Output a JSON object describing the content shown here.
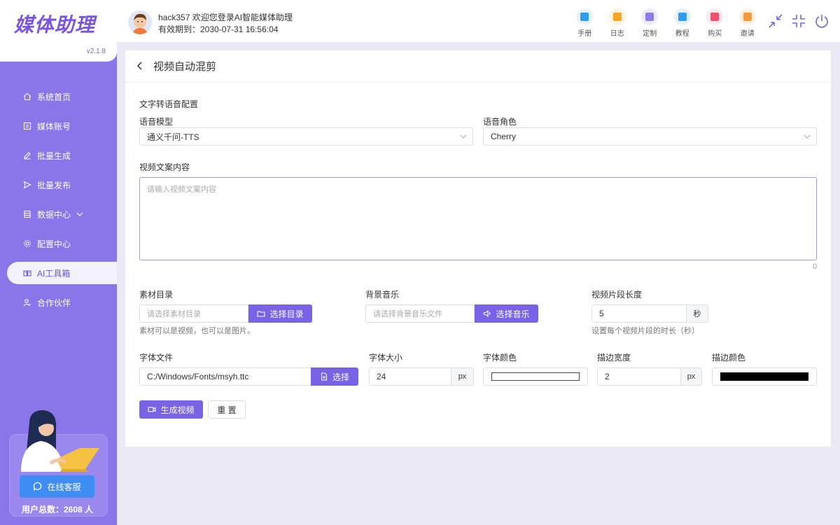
{
  "app": {
    "logo": "媒体助理",
    "version": "v2.1.8"
  },
  "sidebar": {
    "items": [
      {
        "label": "系统首页",
        "icon": "home-icon"
      },
      {
        "label": "媒体账号",
        "icon": "account-icon"
      },
      {
        "label": "批量生成",
        "icon": "edit-icon"
      },
      {
        "label": "批量发布",
        "icon": "send-icon"
      },
      {
        "label": "数据中心",
        "icon": "data-icon"
      },
      {
        "label": "配置中心",
        "icon": "settings-icon"
      },
      {
        "label": "AI工具箱",
        "icon": "toolbox-icon"
      },
      {
        "label": "合作伙伴",
        "icon": "partner-icon"
      }
    ],
    "active_index": 6,
    "support_button": "在线客服",
    "user_total": "用户总数：2608 人"
  },
  "header": {
    "greeting": "hack357 欢迎您登录AI智能媒体助理",
    "expiry": "有效期到：2030-07-31 16:56:04",
    "tools": [
      {
        "label": "手册",
        "color": "#2d9bf0",
        "bg": "#e6f3fe"
      },
      {
        "label": "日志",
        "color": "#f5a623",
        "bg": "#fff3e0"
      },
      {
        "label": "定制",
        "color": "#8e7be8",
        "bg": "#efebfc"
      },
      {
        "label": "教程",
        "color": "#2d9bf0",
        "bg": "#e3f1fd"
      },
      {
        "label": "购买",
        "color": "#f0506e",
        "bg": "#fde8ec"
      },
      {
        "label": "邀请",
        "color": "#f59a3a",
        "bg": "#fff0e0"
      }
    ]
  },
  "page": {
    "title": "视频自动混剪",
    "tts_section": "文字转语音配置",
    "voice_model_label": "语音模型",
    "voice_model_value": "通义千问-TTS",
    "voice_role_label": "语音角色",
    "voice_role_value": "Cherry",
    "content_label": "视频文案内容",
    "content_placeholder": "请输入视频文案内容",
    "content_count": "0",
    "material_label": "素材目录",
    "material_placeholder": "请选择素材目录",
    "material_button": "选择目录",
    "material_hint": "素材可以是视频，也可以是图片。",
    "music_label": "背景音乐",
    "music_placeholder": "请选择背景音乐文件",
    "music_button": "选择音乐",
    "segment_label": "视频片段长度",
    "segment_value": "5",
    "segment_unit": "秒",
    "segment_hint": "设置每个视频片段的时长（秒）",
    "font_file_label": "字体文件",
    "font_file_value": "C:/Windows/Fonts/msyh.ttc",
    "font_file_button": "选择",
    "font_size_label": "字体大小",
    "font_size_value": "24",
    "font_size_unit": "px",
    "font_color_label": "字体颜色",
    "font_color": "#ffffff",
    "stroke_width_label": "描边宽度",
    "stroke_width_value": "2",
    "stroke_width_unit": "px",
    "stroke_color_label": "描边颜色",
    "stroke_color": "#000000",
    "generate_button": "生成视频",
    "reset_button": "重 置"
  }
}
